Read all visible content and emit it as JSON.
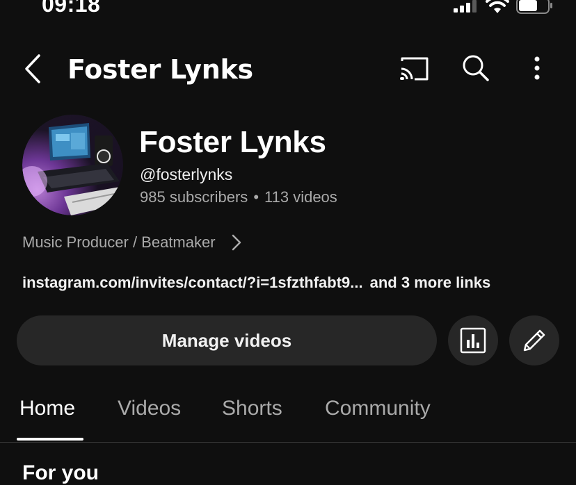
{
  "status_bar": {
    "time": "09:18"
  },
  "top_bar": {
    "title": "Foster Lynks"
  },
  "channel": {
    "name": "Foster Lynks",
    "handle": "@fosterlynks",
    "subscribers": "985 subscribers",
    "separator": "•",
    "videos": "113 videos",
    "description": "Music Producer / Beatmaker",
    "link": "instagram.com/invites/contact/?i=1sfzthfabt9...",
    "more_links": "and 3 more links"
  },
  "actions": {
    "manage_videos": "Manage videos"
  },
  "tabs": [
    {
      "label": "Home",
      "active": true
    },
    {
      "label": "Videos",
      "active": false
    },
    {
      "label": "Shorts",
      "active": false
    },
    {
      "label": "Community",
      "active": false
    }
  ],
  "section": {
    "heading": "For you"
  },
  "colors": {
    "background": "#0f0f0f",
    "button_bg": "#272727",
    "secondary_text": "#aaaaaa",
    "primary_text": "#f1f1f1"
  },
  "icons": {
    "back": "chevron-left-icon",
    "cast": "cast-icon",
    "search": "search-icon",
    "more": "more-vertical-icon",
    "about_chevron": "chevron-right-icon",
    "analytics": "analytics-icon",
    "edit": "pencil-icon"
  }
}
